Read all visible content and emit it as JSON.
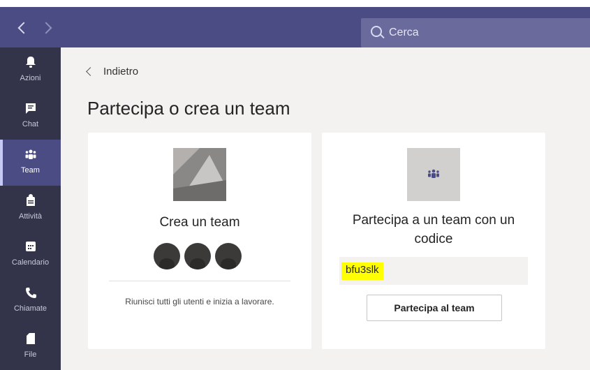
{
  "topbar": {
    "search_placeholder": "Cerca"
  },
  "rail": {
    "items": [
      {
        "label": "Azioni",
        "icon": "bell-icon"
      },
      {
        "label": "Chat",
        "icon": "chat-icon"
      },
      {
        "label": "Team",
        "icon": "team-icon",
        "active": true
      },
      {
        "label": "Attività",
        "icon": "backpack-icon"
      },
      {
        "label": "Calendario",
        "icon": "calendar-icon"
      },
      {
        "label": "Chiamate",
        "icon": "phone-icon"
      },
      {
        "label": "File",
        "icon": "file-icon"
      }
    ]
  },
  "main": {
    "back_label": "Indietro",
    "page_title": "Partecipa o crea un team",
    "create_card": {
      "title": "Crea un team",
      "description": "Riunisci tutti gli utenti e inizia a lavorare."
    },
    "join_card": {
      "title_line1": "Partecipa a un team con un",
      "title_line2": "codice",
      "code_value": "bfu3slk",
      "button_label": "Partecipa al team"
    }
  },
  "colors": {
    "topbar": "#4b4c84",
    "rail": "#33344a",
    "highlight": "#ffff00"
  }
}
